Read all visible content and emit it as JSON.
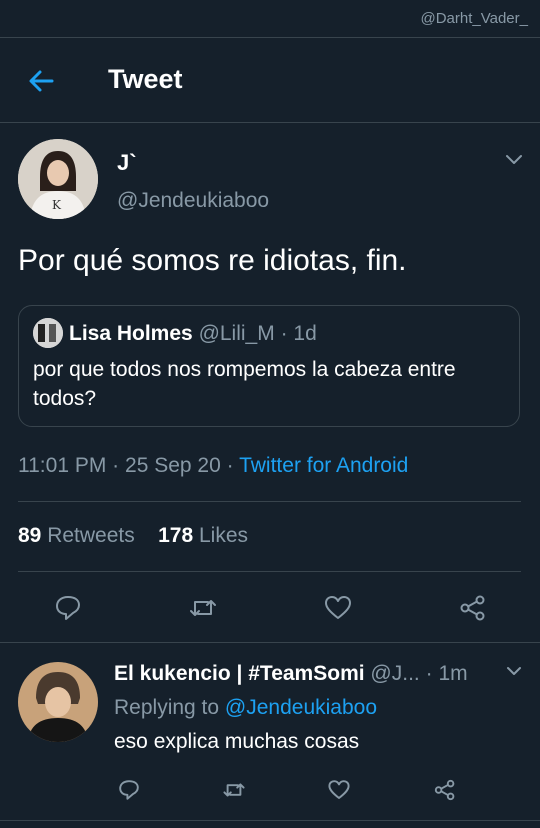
{
  "watermark": "@Darht_Vader_",
  "header": {
    "title": "Tweet"
  },
  "tweet": {
    "author_name": "J`",
    "author_handle": "@Jendeukiaboo",
    "text": "Por qué somos re idiotas, fin.",
    "quote": {
      "name": "Lisa Holmes",
      "handle": "@Lili_M",
      "separator": "·",
      "time": "1d",
      "text": "por que todos nos rompemos la cabeza entre todos?"
    },
    "time": "11:01 PM",
    "dot1": "·",
    "date": "25 Sep 20",
    "dot2": "·",
    "client": "Twitter for Android",
    "retweets_count": "89",
    "retweets_label": "Retweets",
    "likes_count": "178",
    "likes_label": "Likes"
  },
  "actions": [
    "reply-icon",
    "retweet-icon",
    "like-icon",
    "share-icon"
  ],
  "reply": {
    "name": "El kukencio | #TeamSomi",
    "handle": "@J...",
    "separator": "·",
    "time": "1m",
    "replying_prefix": "Replying to",
    "replying_handle": "@Jendeukiaboo",
    "text": "eso explica muchas cosas"
  },
  "colors": {
    "background": "#15202b",
    "accent": "#1da1f2",
    "muted": "#8899a6",
    "divider": "#38444d"
  }
}
